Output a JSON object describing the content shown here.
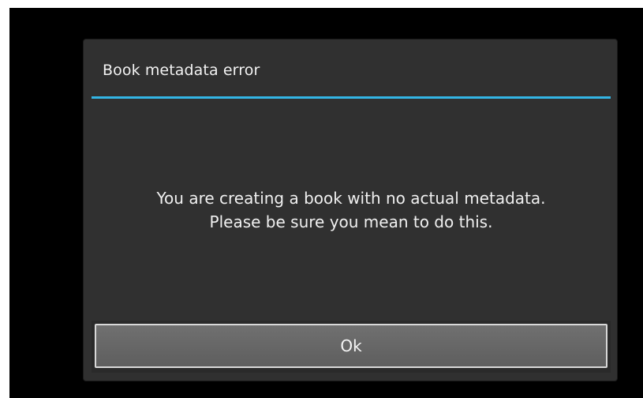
{
  "dialog": {
    "title": "Book metadata error",
    "message_line1": "You are creating a book with no actual metadata.",
    "message_line2": "Please be sure you mean to do this.",
    "ok_label": "Ok"
  },
  "colors": {
    "accent": "#33b5e5",
    "dialog_background": "#303030",
    "screen_background": "#000000"
  }
}
